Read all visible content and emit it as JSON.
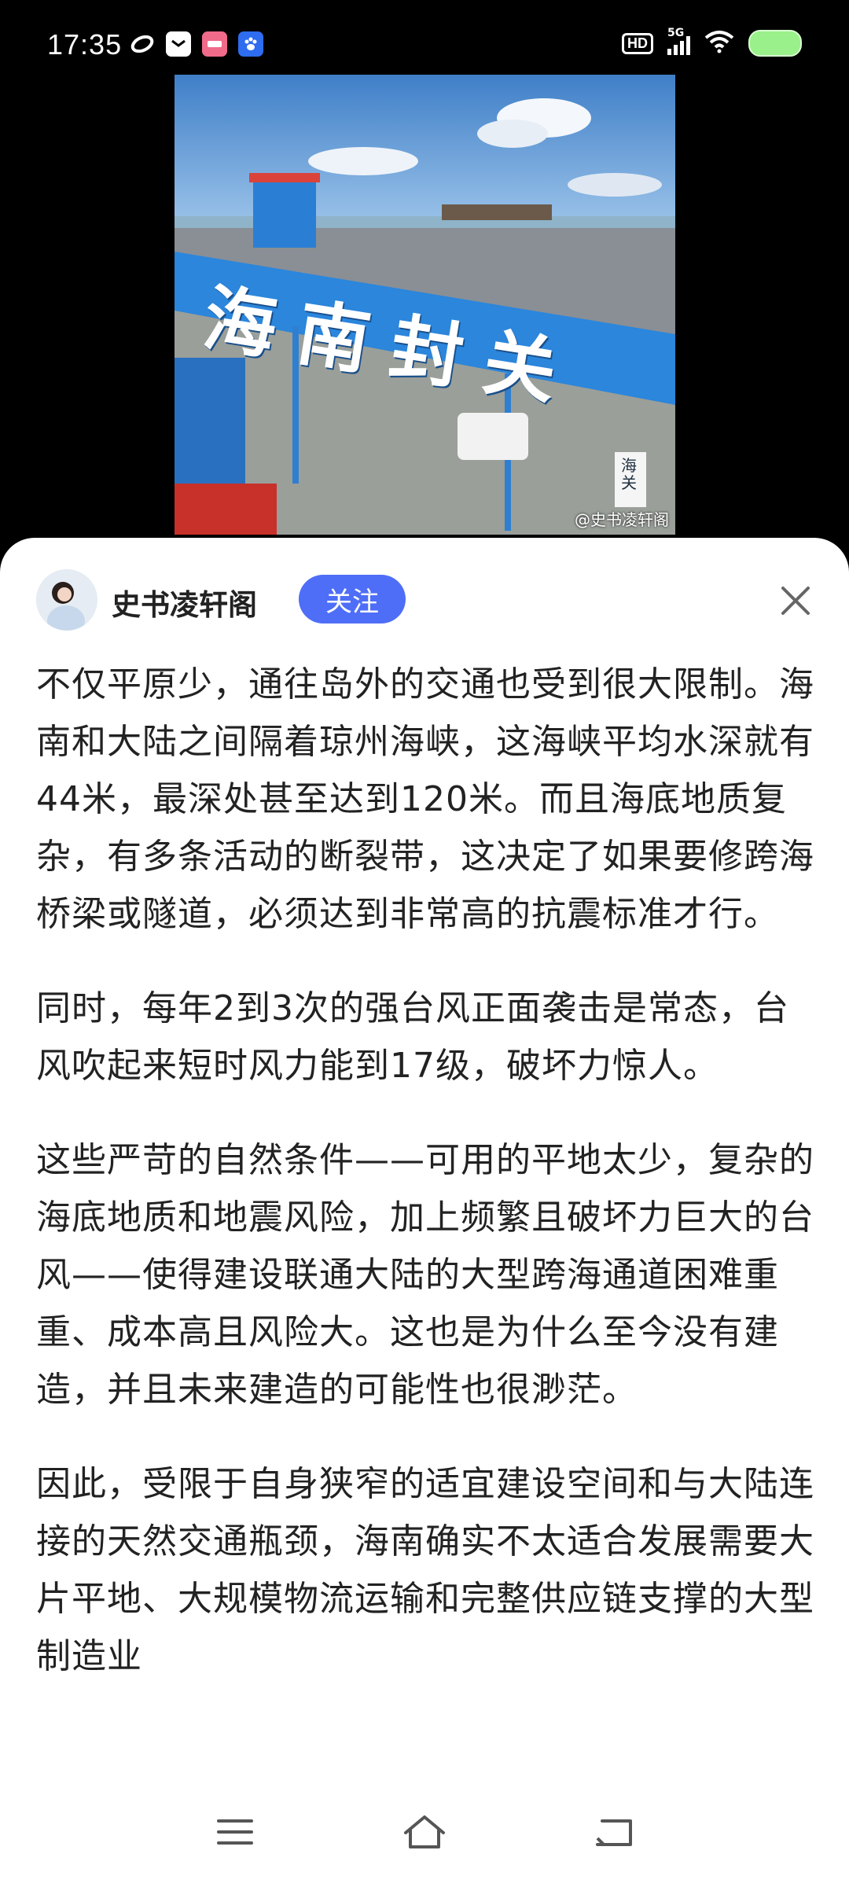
{
  "status_bar": {
    "time": "17:35",
    "network_label": "5G",
    "hd_label": "HD",
    "left_icons": [
      "app-icon-a",
      "message-icon",
      "app-icon-b",
      "baidu-paw-icon"
    ],
    "battery_color": "#9af08a"
  },
  "photo": {
    "sign_text": "海南封关",
    "watermark": "@史书凌轩阁",
    "side_sign": "海关"
  },
  "post": {
    "author": "史书凌轩阁",
    "follow_label": "关注",
    "follow_color": "#4f6ef7",
    "paragraphs": [
      "不仅平原少，通往岛外的交通也受到很大限制。海南和大陆之间隔着琼州海峡，这海峡平均水深就有44米，最深处甚至达到120米。而且海底地质复杂，有多条活动的断裂带，这决定了如果要修跨海桥梁或隧道，必须达到非常高的抗震标准才行。",
      "同时，每年2到3次的强台风正面袭击是常态，台风吹起来短时风力能到17级，破坏力惊人。",
      "这些严苛的自然条件——可用的平地太少，复杂的海底地质和地震风险，加上频繁且破坏力巨大的台风——使得建设联通大陆的大型跨海通道困难重重、成本高且风险大。这也是为什么至今没有建造，并且未来建造的可能性也很渺茫。",
      "因此，受限于自身狭窄的适宜建设空间和与大陆连接的天然交通瓶颈，海南确实不太适合发展需要大片平地、大规模物流运输和完整供应链支撑的大型制造业"
    ]
  },
  "nav": {
    "buttons": [
      "menu-icon",
      "home-icon",
      "back-icon"
    ]
  }
}
